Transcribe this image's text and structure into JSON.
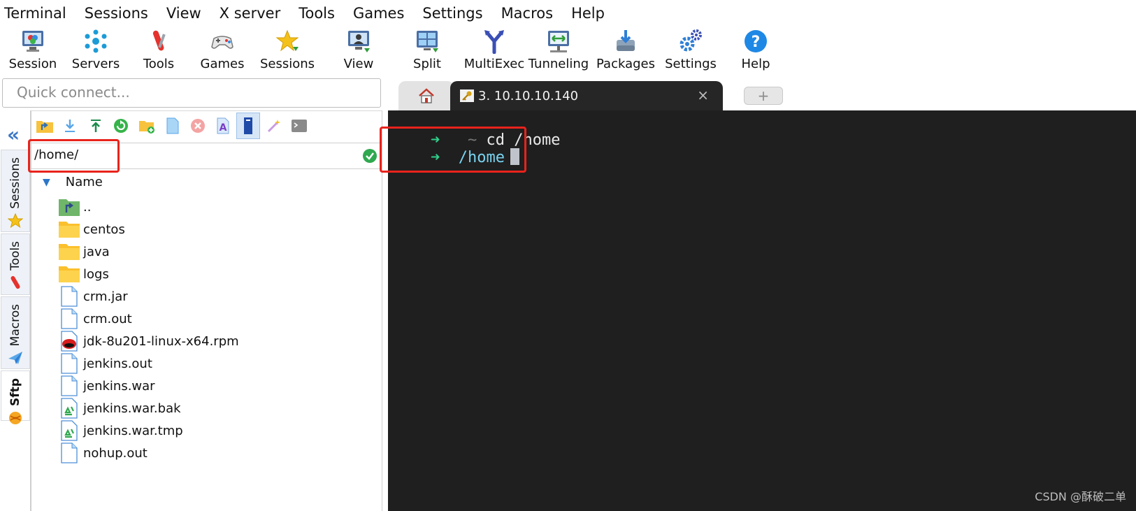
{
  "menu": [
    "Terminal",
    "Sessions",
    "View",
    "X server",
    "Tools",
    "Games",
    "Settings",
    "Macros",
    "Help"
  ],
  "toolbar": [
    {
      "label": "Session",
      "icon": "session-icon"
    },
    {
      "label": "Servers",
      "icon": "servers-icon"
    },
    {
      "label": "Tools",
      "icon": "tools-icon"
    },
    {
      "label": "Games",
      "icon": "games-icon"
    },
    {
      "label": "Sessions",
      "icon": "sessions-star-icon"
    },
    {
      "label": "View",
      "icon": "view-icon"
    },
    {
      "label": "Split",
      "icon": "split-icon"
    },
    {
      "label": "MultiExec",
      "icon": "multiexec-icon"
    },
    {
      "label": "Tunneling",
      "icon": "tunneling-icon"
    },
    {
      "label": "Packages",
      "icon": "packages-icon"
    },
    {
      "label": "Settings",
      "icon": "settings-icon"
    },
    {
      "label": "Help",
      "icon": "help-icon"
    }
  ],
  "quick_connect": {
    "placeholder": "Quick connect..."
  },
  "tabs": {
    "active_title": "3. 10.10.10.140",
    "close": "×",
    "new": "+"
  },
  "side_tabs": [
    "Sessions",
    "Tools",
    "Macros",
    "Sftp"
  ],
  "sftp": {
    "path": "/home/",
    "column_header": "Name",
    "files": [
      {
        "name": "..",
        "icon": "parent-folder-icon"
      },
      {
        "name": "centos",
        "icon": "folder-icon"
      },
      {
        "name": "java",
        "icon": "folder-icon"
      },
      {
        "name": "logs",
        "icon": "folder-icon"
      },
      {
        "name": "crm.jar",
        "icon": "file-icon"
      },
      {
        "name": "crm.out",
        "icon": "file-icon"
      },
      {
        "name": "jdk-8u201-linux-x64.rpm",
        "icon": "redhat-package-icon"
      },
      {
        "name": "jenkins.out",
        "icon": "file-icon"
      },
      {
        "name": "jenkins.war",
        "icon": "file-icon"
      },
      {
        "name": "jenkins.war.bak",
        "icon": "recycle-file-icon"
      },
      {
        "name": "jenkins.war.tmp",
        "icon": "recycle-file-icon"
      },
      {
        "name": "nohup.out",
        "icon": "file-icon"
      }
    ]
  },
  "terminal": {
    "line1": {
      "arrow": "➜",
      "prompt": "~",
      "command": "cd /home"
    },
    "line2": {
      "arrow": "➜",
      "cwd": "/home"
    }
  },
  "watermark": "CSDN @酥破二单",
  "colors": {
    "highlight": "#e8231c",
    "terminal_bg": "#1f1f1f",
    "prompt_arrow": "#2fd08a",
    "cwd": "#79d3f0"
  }
}
